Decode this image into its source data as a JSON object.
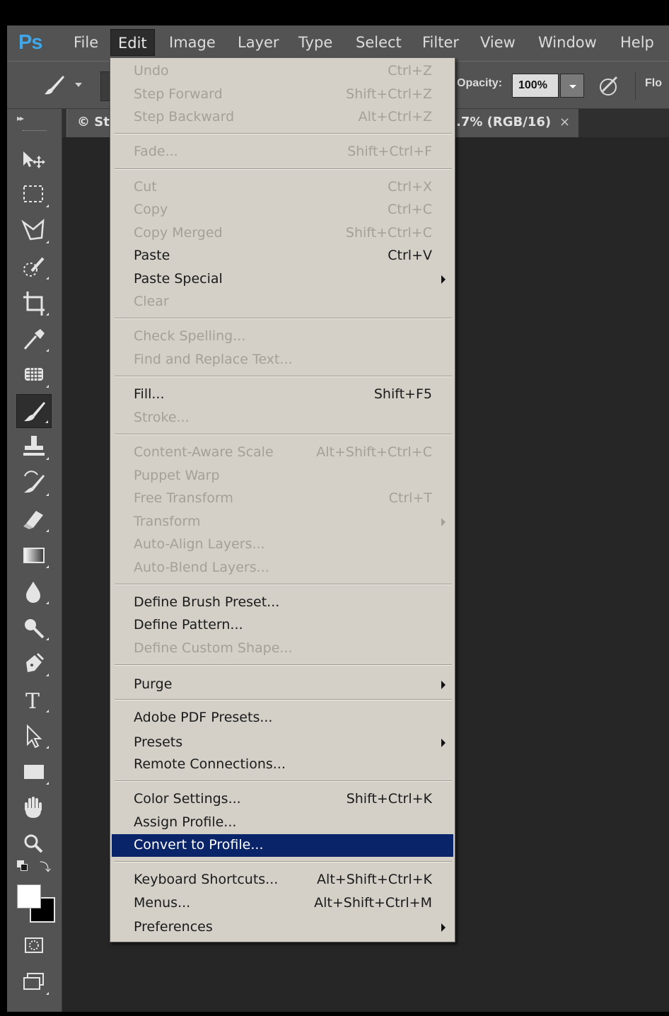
{
  "app": {
    "logo": "Ps"
  },
  "menubar": {
    "items": [
      "File",
      "Edit",
      "Image",
      "Layer",
      "Type",
      "Select",
      "Filter",
      "View",
      "Window",
      "Help"
    ]
  },
  "options_bar": {
    "opacity_label": "Opacity:",
    "opacity_value": "100%",
    "flow_label": "Flo"
  },
  "document_tab": {
    "title_left": "© St",
    "title_right": ".7% (RGB/16)",
    "close": "×"
  },
  "edit_menu": {
    "items": [
      {
        "label": "Undo",
        "shortcut": "Ctrl+Z",
        "enabled": false
      },
      {
        "label": "Step Forward",
        "shortcut": "Shift+Ctrl+Z",
        "enabled": false
      },
      {
        "label": "Step Backward",
        "shortcut": "Alt+Ctrl+Z",
        "enabled": false
      },
      {
        "label": "Fade...",
        "shortcut": "Shift+Ctrl+F",
        "enabled": false
      },
      {
        "label": "Cut",
        "shortcut": "Ctrl+X",
        "enabled": false
      },
      {
        "label": "Copy",
        "shortcut": "Ctrl+C",
        "enabled": false
      },
      {
        "label": "Copy Merged",
        "shortcut": "Shift+Ctrl+C",
        "enabled": false
      },
      {
        "label": "Paste",
        "shortcut": "Ctrl+V",
        "enabled": true
      },
      {
        "label": "Paste Special",
        "shortcut": "",
        "enabled": true,
        "submenu": true
      },
      {
        "label": "Clear",
        "shortcut": "",
        "enabled": false
      },
      {
        "label": "Check Spelling...",
        "shortcut": "",
        "enabled": false
      },
      {
        "label": "Find and Replace Text...",
        "shortcut": "",
        "enabled": false
      },
      {
        "label": "Fill...",
        "shortcut": "Shift+F5",
        "enabled": true
      },
      {
        "label": "Stroke...",
        "shortcut": "",
        "enabled": false
      },
      {
        "label": "Content-Aware Scale",
        "shortcut": "Alt+Shift+Ctrl+C",
        "enabled": false
      },
      {
        "label": "Puppet Warp",
        "shortcut": "",
        "enabled": false
      },
      {
        "label": "Free Transform",
        "shortcut": "Ctrl+T",
        "enabled": false
      },
      {
        "label": "Transform",
        "shortcut": "",
        "enabled": false,
        "submenu": true
      },
      {
        "label": "Auto-Align Layers...",
        "shortcut": "",
        "enabled": false
      },
      {
        "label": "Auto-Blend Layers...",
        "shortcut": "",
        "enabled": false
      },
      {
        "label": "Define Brush Preset...",
        "shortcut": "",
        "enabled": true
      },
      {
        "label": "Define Pattern...",
        "shortcut": "",
        "enabled": true
      },
      {
        "label": "Define Custom Shape...",
        "shortcut": "",
        "enabled": false
      },
      {
        "label": "Purge",
        "shortcut": "",
        "enabled": true,
        "submenu": true
      },
      {
        "label": "Adobe PDF Presets...",
        "shortcut": "",
        "enabled": true
      },
      {
        "label": "Presets",
        "shortcut": "",
        "enabled": true,
        "submenu": true
      },
      {
        "label": "Remote Connections...",
        "shortcut": "",
        "enabled": true
      },
      {
        "label": "Color Settings...",
        "shortcut": "Shift+Ctrl+K",
        "enabled": true
      },
      {
        "label": "Assign Profile...",
        "shortcut": "",
        "enabled": true
      },
      {
        "label": "Convert to Profile...",
        "shortcut": "",
        "enabled": true,
        "highlighted": true
      },
      {
        "label": "Keyboard Shortcuts...",
        "shortcut": "Alt+Shift+Ctrl+K",
        "enabled": true
      },
      {
        "label": "Menus...",
        "shortcut": "Alt+Shift+Ctrl+M",
        "enabled": true
      },
      {
        "label": "Preferences",
        "shortcut": "",
        "enabled": true,
        "submenu": true
      }
    ]
  },
  "toolbox": {
    "tools": [
      "move-tool",
      "marquee-tool",
      "lasso-tool",
      "quick-selection-tool",
      "crop-tool",
      "eyedropper-tool",
      "spot-healing-tool",
      "brush-tool",
      "clone-stamp-tool",
      "history-brush-tool",
      "eraser-tool",
      "gradient-tool",
      "blur-tool",
      "dodge-tool",
      "pen-tool",
      "type-tool",
      "path-selection-tool",
      "rectangle-tool",
      "hand-tool",
      "zoom-tool"
    ],
    "selected_tool": "brush-tool",
    "foreground_color": "#ffffff",
    "background_color": "#000000"
  },
  "colors": {
    "menu_highlight": "#0a246a",
    "menu_background": "#d4d0c8",
    "ui_panel": "#535353",
    "workspace": "#262626"
  }
}
